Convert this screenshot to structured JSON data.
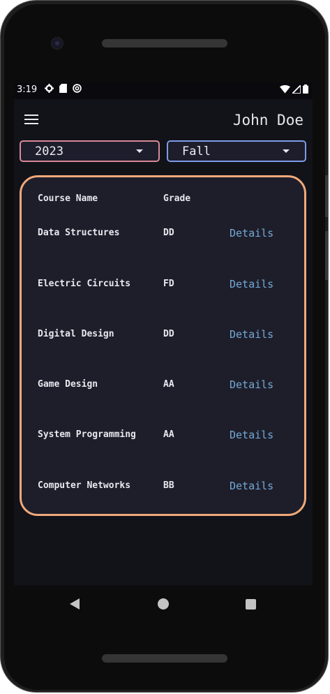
{
  "status_bar": {
    "time": "3:19",
    "icons_left": [
      "gear-icon",
      "sd-card-icon",
      "at-sign-icon"
    ],
    "icons_right": [
      "wifi-icon",
      "signal-icon",
      "battery-icon"
    ]
  },
  "app_bar": {
    "menu_icon": "hamburger-menu-icon",
    "user_name": "John Doe"
  },
  "filters": {
    "year": "2023",
    "term": "Fall"
  },
  "table": {
    "headers": [
      "Course Name",
      "Grade"
    ],
    "rows": [
      {
        "course": "Data Structures",
        "grade": "DD",
        "action": "Details"
      },
      {
        "course": "Electric Circuits",
        "grade": "FD",
        "action": "Details"
      },
      {
        "course": "Digital Design",
        "grade": "DD",
        "action": "Details"
      },
      {
        "course": "Game Design",
        "grade": "AA",
        "action": "Details"
      },
      {
        "course": "System Programming",
        "grade": "AA",
        "action": "Details"
      },
      {
        "course": "Computer Networks",
        "grade": "BB",
        "action": "Details"
      }
    ]
  },
  "nav_bar": {
    "back": "back-icon",
    "home": "home-icon",
    "recents": "recents-icon"
  },
  "colors": {
    "year_border": "#d98a98",
    "term_border": "#7e9be6",
    "card_border": "#f0a97a",
    "link": "#74a9d6",
    "background": "#121219"
  }
}
